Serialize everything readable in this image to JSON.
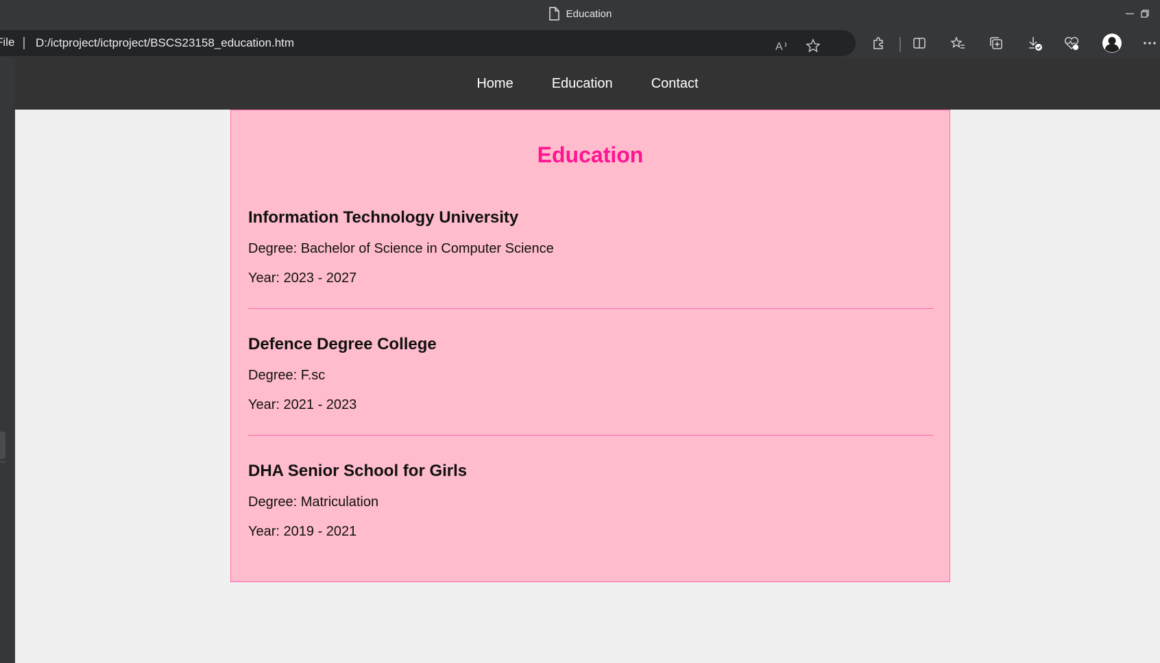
{
  "window": {
    "title": "Education"
  },
  "address_bar": {
    "scheme_label": "File",
    "url": "D:/ictproject/ictproject/BSCS23158_education.htm"
  },
  "toolbar_icons": [
    "read-aloud-icon",
    "favorite-star-icon",
    "extensions-icon",
    "split-screen-icon",
    "favorites-icon",
    "collections-icon",
    "downloads-icon",
    "browser-essentials-icon",
    "profile-icon",
    "more-icon"
  ],
  "nav": {
    "items": [
      {
        "label": "Home"
      },
      {
        "label": "Education"
      },
      {
        "label": "Contact"
      }
    ]
  },
  "content": {
    "heading": "Education",
    "entries": [
      {
        "institution": "Information Technology University",
        "degree": "Degree: Bachelor of Science in Computer Science",
        "year": "Year: 2023 - 2027"
      },
      {
        "institution": "Defence Degree College",
        "degree": "Degree: F.sc",
        "year": "Year: 2021 - 2023"
      },
      {
        "institution": "DHA Senior School for Girls",
        "degree": "Degree: Matriculation",
        "year": "Year: 2019 - 2021"
      }
    ]
  },
  "colors": {
    "navbar_bg": "#333333",
    "card_bg": "#ffbccc",
    "card_border": "#ff69b4",
    "heading": "#ff1493",
    "page_bg": "#f0f0f0"
  }
}
